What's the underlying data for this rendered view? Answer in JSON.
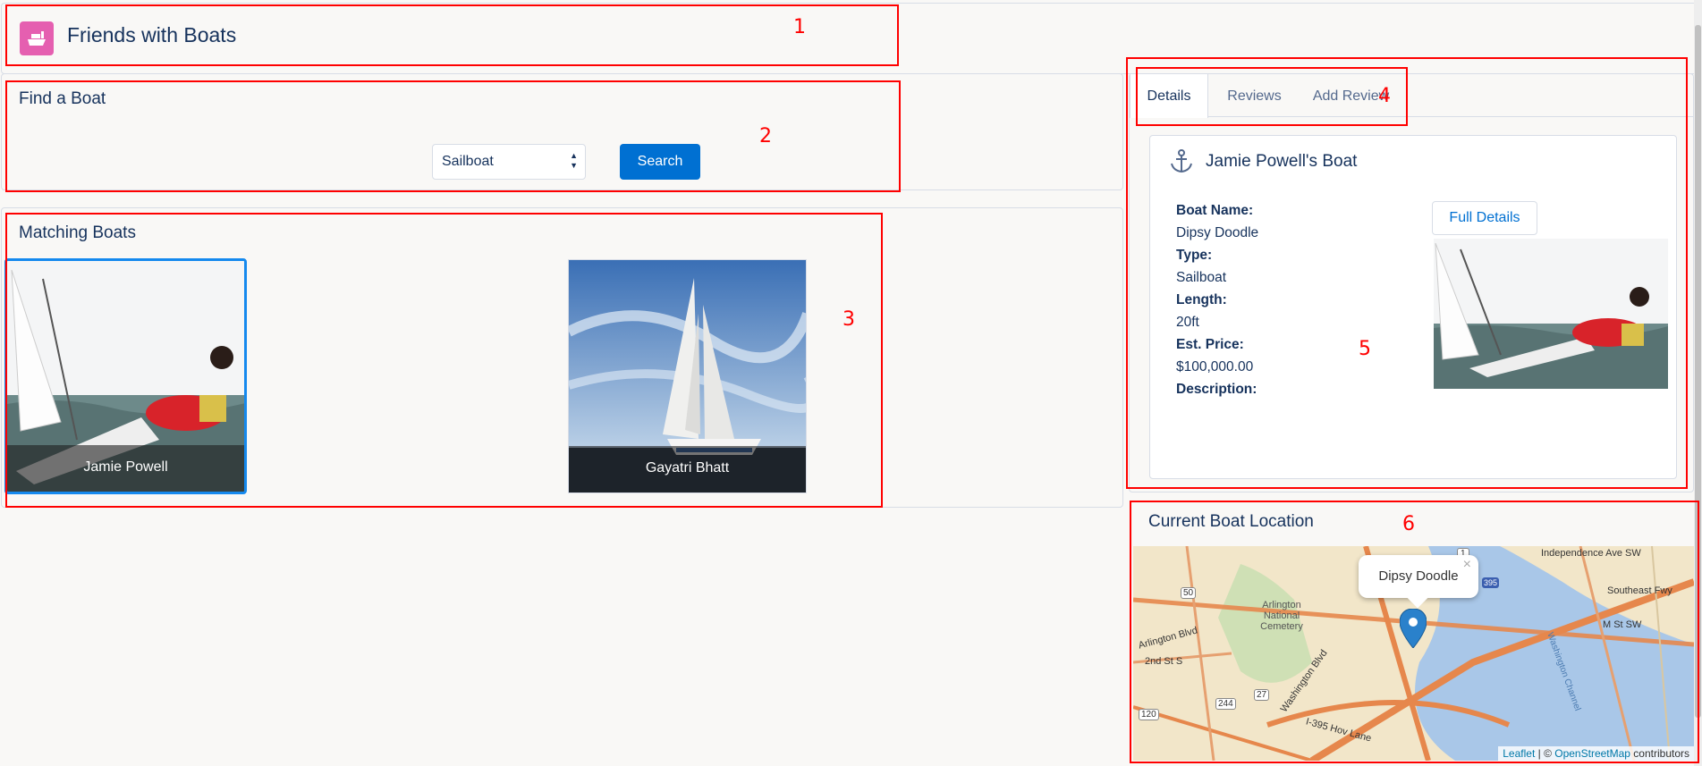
{
  "app": {
    "title": "Friends with Boats"
  },
  "find": {
    "title": "Find a Boat",
    "boat_type_selected": "Sailboat",
    "search_label": "Search"
  },
  "matching": {
    "title": "Matching Boats",
    "boats": [
      {
        "owner": "Jamie Powell",
        "selected": true
      },
      {
        "owner": "Gayatri Bhatt",
        "selected": false
      }
    ]
  },
  "details": {
    "tabs": [
      {
        "label": "Details",
        "active": true
      },
      {
        "label": "Reviews",
        "active": false
      },
      {
        "label": "Add Review",
        "active": false
      }
    ],
    "boat_title": "Jamie Powell's Boat",
    "full_details_label": "Full Details",
    "fields": {
      "name_label": "Boat Name:",
      "name": "Dipsy Doodle",
      "type_label": "Type:",
      "type": "Sailboat",
      "length_label": "Length:",
      "length": "20ft",
      "price_label": "Est. Price:",
      "price": "$100,000.00",
      "description_label": "Description:",
      "description": ""
    }
  },
  "location": {
    "title": "Current Boat Location",
    "popup_label": "Dipsy Doodle",
    "popup_close": "×",
    "map_labels": {
      "cemetery": "Arlington National Cemetery",
      "independence": "Independence Ave SW",
      "southeast": "Southeast Fwy",
      "msw": "M St SW",
      "channel": "Washington Channel",
      "arl_blvd": "Arlington Blvd",
      "second_st": "2nd St S",
      "wash_blvd": "Washington Blvd",
      "route_50": "50",
      "route_27": "27",
      "route_244": "244",
      "route_120": "120",
      "route_1": "1",
      "route_395": "395",
      "hov": "I-395 Hov Lane"
    },
    "attribution": {
      "leaflet": "Leaflet",
      "sep": " | © ",
      "osm": "OpenStreetMap",
      "suffix": " contributors"
    }
  },
  "annotations": [
    "1",
    "2",
    "3",
    "4",
    "5",
    "6"
  ],
  "colors": {
    "brand_blue": "#0070d2",
    "app_icon": "#e55fb0",
    "annotation_red": "#ff0000"
  }
}
